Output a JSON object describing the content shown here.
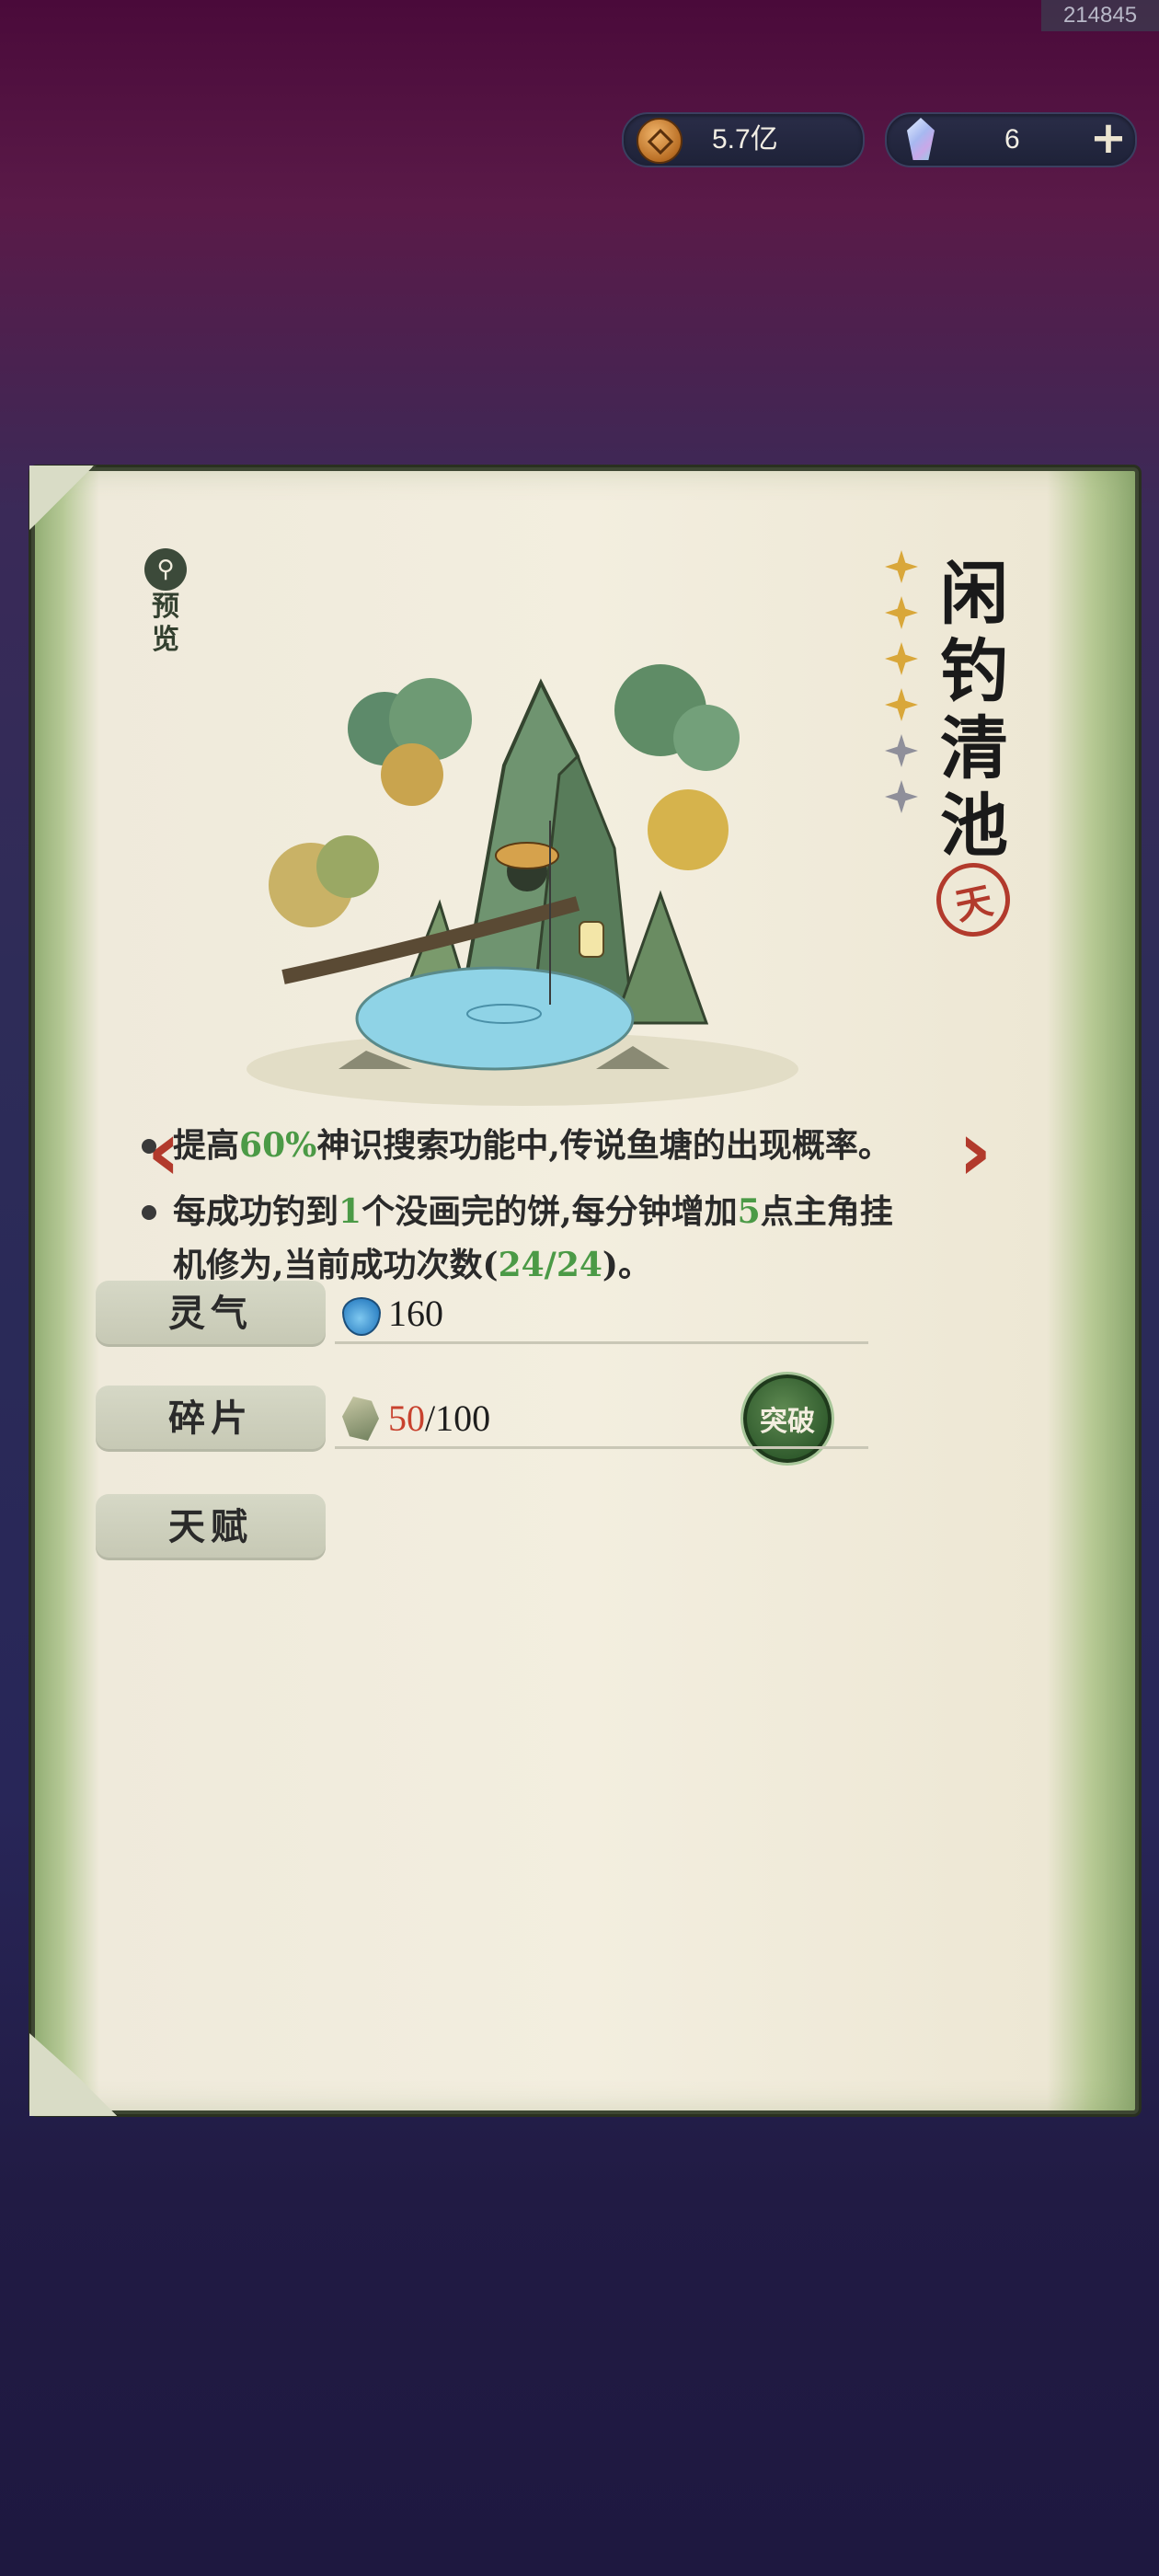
{
  "corner_id": "214845",
  "currency": {
    "coins": "5.7亿",
    "gems": "6",
    "add_label": "+"
  },
  "preview": {
    "icon_glyph": "⚲",
    "label_1": "预",
    "label_2": "览"
  },
  "title": {
    "chars": [
      "闲",
      "钓",
      "清",
      "池"
    ],
    "rank": "天",
    "stars_total": 6,
    "stars_filled": 4
  },
  "nav": {
    "prev": "‹",
    "next": "›"
  },
  "stats": {
    "aura_label": "灵气",
    "aura_value": "160",
    "shard_label": "碎片",
    "shard_current": "50",
    "shard_total": "/100",
    "break_label": "突破",
    "talent_label": "天赋"
  },
  "talents": [
    {
      "pre": "提高",
      "hl1": "60%",
      "mid": "神识搜索功能中,传说鱼塘的出现概率。"
    },
    {
      "pre": "每成功钓到",
      "hl1": "1",
      "mid": "个没画完的饼,每分钟增加",
      "hl2": "5",
      "mid2": "点主角挂机修为,当前成功次数(",
      "hl3": "24/24",
      "post": ")。"
    }
  ],
  "colors": {
    "highlight": "#4b9a46",
    "shard_current": "#c8422e",
    "accent_red": "#b23a2c"
  }
}
